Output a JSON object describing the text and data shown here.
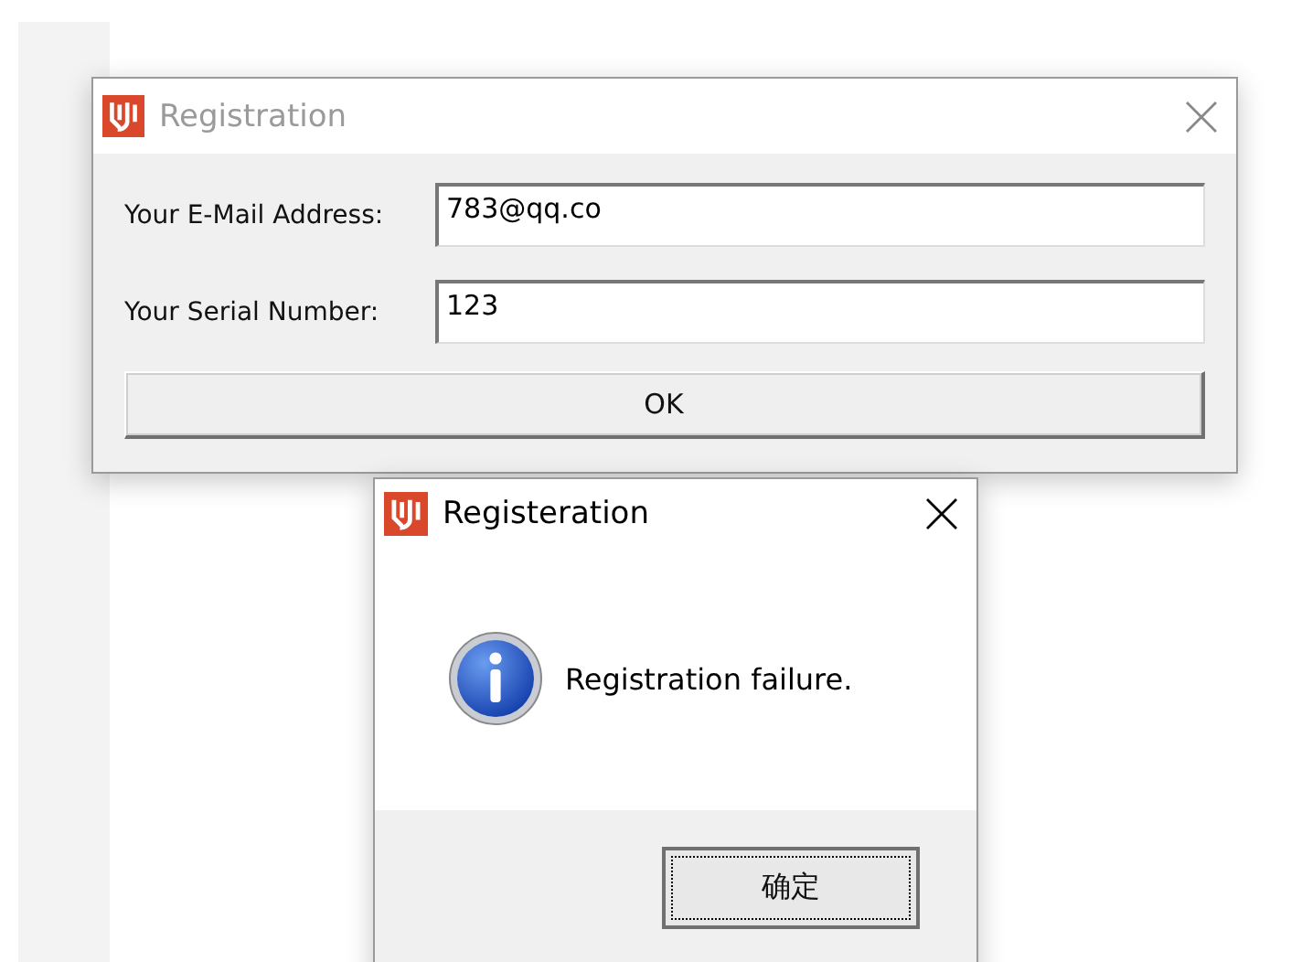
{
  "windows": [
    {
      "kind": "form",
      "title": "Registration",
      "active": false,
      "fields": [
        {
          "label": "Your E-Mail Address:",
          "value": "783@qq.co"
        },
        {
          "label": "Your Serial Number:",
          "value": "123"
        }
      ],
      "button": "OK"
    },
    {
      "kind": "message",
      "title": "Registeration",
      "active": true,
      "message": "Registration failure.",
      "button": "确定"
    }
  ]
}
